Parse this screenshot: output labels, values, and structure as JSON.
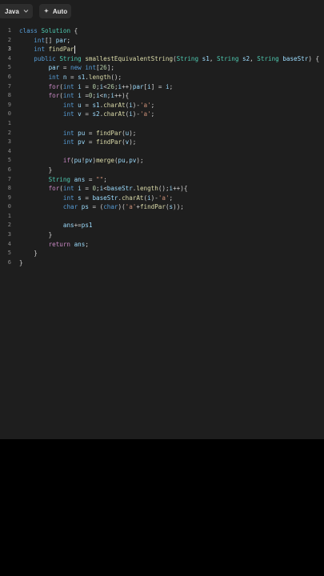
{
  "toolbar": {
    "language_label": "Java",
    "auto_label": "Auto"
  },
  "editor": {
    "line_numbers": [
      "1",
      "2",
      "3",
      "4",
      "5",
      "6",
      "7",
      "8",
      "9",
      "0",
      "1",
      "2",
      "3",
      "4",
      "5",
      "6",
      "7",
      "8",
      "9",
      "0",
      "1",
      "2",
      "3",
      "4",
      "5",
      "6"
    ],
    "active_line_index": 2,
    "code_lines": [
      "class Solution {",
      "    int[] par;",
      "    int findPar",
      "    public String smallestEquivalentString(String s1, String s2, String baseStr) {",
      "        par = new int[26];",
      "        int n = s1.length();",
      "        for(int i = 0;i<26;i++)par[i] = i;",
      "        for(int i =0;i<n;i++){",
      "            int u = s1.charAt(i)-'a';",
      "            int v = s2.charAt(i)-'a';",
      "",
      "            int pu = findPar(u);",
      "            int pv = findPar(v);",
      "",
      "            if(pu!pv)merge(pu,pv);",
      "        }",
      "        String ans = \"\";",
      "        for(int i = 0;i<baseStr.length();i++){",
      "            int s = baseStr.charAt(i)-'a';",
      "            char ps = (char)('a'+findPar(s));",
      "",
      "            ans+=ps1",
      "        }",
      "        return ans;",
      "    }",
      "}"
    ]
  }
}
